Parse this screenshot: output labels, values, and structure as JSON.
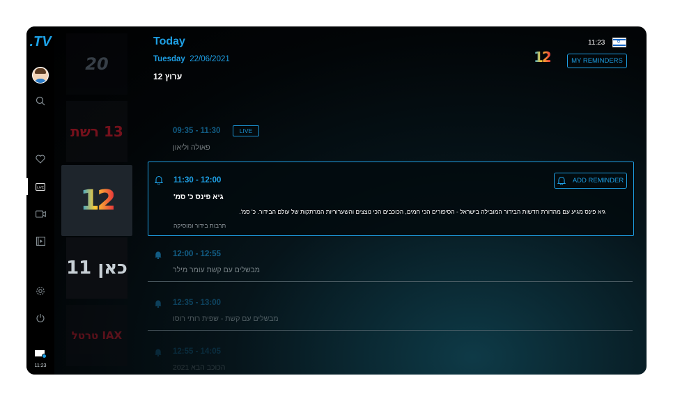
{
  "sidebar": {
    "logo": ".TV",
    "clock": "11:23",
    "icons": [
      "user-avatar",
      "search-icon",
      "heart-icon",
      "live-tv-icon",
      "video-icon",
      "recordings-icon",
      "settings-icon",
      "power-icon",
      "tv-status-icon"
    ],
    "live_badge": "LIVE"
  },
  "channels": [
    {
      "label": "20"
    },
    {
      "label": "13 רשת"
    },
    {
      "label": "12"
    },
    {
      "label": "כאן 11"
    },
    {
      "label": "טרטל IAX"
    }
  ],
  "header": {
    "title": "Today",
    "day": "Tuesday",
    "date": "22/06/2021",
    "channel_name": "ערוץ 12",
    "clock": "11:23",
    "logo": "12",
    "my_reminders": "MY REMINDERS"
  },
  "programs": [
    {
      "time": "09:35 - 11:30",
      "title": "פאולה וליאון",
      "badge": "LIVE"
    },
    {
      "time": "11:30 - 12:00",
      "title": "גיא פינס כ' סמ'",
      "description": "גיא פינס מגיע עם מהדורת חדשות הבידור המובילה בישראל - הסיפורים הכי חמים, הכוכבים הכי נוצצים והשערוריות המרתקות של עולם הבידור. כ' סמ'.",
      "genre": "תרבות בידור ומוסיקה",
      "button": "ADD REMINDER"
    },
    {
      "time": "12:00 - 12:55",
      "title": "מבשלים עם קשת עומר מילר"
    },
    {
      "time": "12:35 - 13:00",
      "title": "מבשלים עם קשת - שפית רותי רוסו"
    },
    {
      "time": "12:55 - 14:05",
      "title": "הכוכב הבא 2021"
    }
  ],
  "colors": {
    "accent": "#1e9fe4",
    "background": "#020507"
  }
}
